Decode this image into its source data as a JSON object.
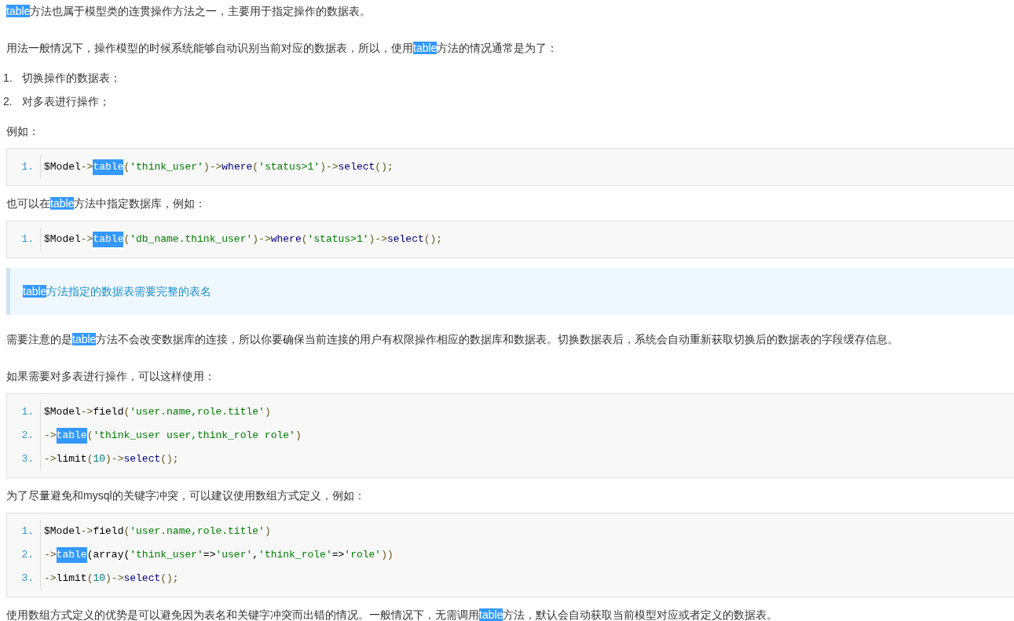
{
  "content": [
    {
      "kind": "paragraph",
      "segments": [
        {
          "text": "table",
          "highlighted": true
        },
        {
          "text": "方法也属于模型类的连贯操作方法之一，主要用于指定操作的数据表。",
          "highlighted": false
        }
      ]
    },
    {
      "kind": "paragraph",
      "segments": [
        {
          "text": "用法一般情况下，操作模型的时候系统能够自动识别当前对应的数据表，所以，使用",
          "highlighted": false
        },
        {
          "text": "table",
          "highlighted": true
        },
        {
          "text": "方法的情况通常是为了：",
          "highlighted": false
        }
      ]
    },
    {
      "kind": "list",
      "items": [
        {
          "number": "1.",
          "text": "切换操作的数据表；"
        },
        {
          "number": "2.",
          "text": "对多表进行操作；"
        }
      ]
    },
    {
      "kind": "paragraph",
      "segments": [
        {
          "text": "例如：",
          "highlighted": false
        }
      ]
    },
    {
      "kind": "code",
      "lines": [
        {
          "number": "1.",
          "tokens": [
            {
              "text": "$Model",
              "kind": "plain"
            },
            {
              "text": "->",
              "kind": "punct"
            },
            {
              "text": "table",
              "kind": "highlight"
            },
            {
              "text": "(",
              "kind": "punct"
            },
            {
              "text": "'think_user'",
              "kind": "string"
            },
            {
              "text": ")->",
              "kind": "punct"
            },
            {
              "text": "where",
              "kind": "method"
            },
            {
              "text": "(",
              "kind": "punct"
            },
            {
              "text": "'status>1'",
              "kind": "string"
            },
            {
              "text": ")->",
              "kind": "punct"
            },
            {
              "text": "select",
              "kind": "method"
            },
            {
              "text": "();",
              "kind": "punct"
            }
          ]
        }
      ]
    },
    {
      "kind": "paragraph",
      "segments": [
        {
          "text": "也可以在",
          "highlighted": false
        },
        {
          "text": "table",
          "highlighted": true
        },
        {
          "text": "方法中指定数据库，例如：",
          "highlighted": false
        }
      ]
    },
    {
      "kind": "code",
      "lines": [
        {
          "number": "1.",
          "tokens": [
            {
              "text": "$Model",
              "kind": "plain"
            },
            {
              "text": "->",
              "kind": "punct"
            },
            {
              "text": "table",
              "kind": "highlight"
            },
            {
              "text": "(",
              "kind": "punct"
            },
            {
              "text": "'db_name.think_user'",
              "kind": "string"
            },
            {
              "text": ")->",
              "kind": "punct"
            },
            {
              "text": "where",
              "kind": "method"
            },
            {
              "text": "(",
              "kind": "punct"
            },
            {
              "text": "'status>1'",
              "kind": "string"
            },
            {
              "text": ")->",
              "kind": "punct"
            },
            {
              "text": "select",
              "kind": "method"
            },
            {
              "text": "();",
              "kind": "punct"
            }
          ]
        }
      ]
    },
    {
      "kind": "note",
      "segments": [
        {
          "text": "table",
          "highlighted": true
        },
        {
          "text": "方法指定的数据表需要完整的表名",
          "highlighted": false
        }
      ]
    },
    {
      "kind": "paragraph",
      "segments": [
        {
          "text": "需要注意的是",
          "highlighted": false
        },
        {
          "text": "table",
          "highlighted": true
        },
        {
          "text": "方法不会改变数据库的连接，所以你要确保当前连接的用户有权限操作相应的数据库和数据表。切换数据表后，系统会自动重新获取切换后的数据表的字段缓存信息。",
          "highlighted": false
        }
      ]
    },
    {
      "kind": "paragraph",
      "segments": [
        {
          "text": "如果需要对多表进行操作，可以这样使用：",
          "highlighted": false
        }
      ]
    },
    {
      "kind": "code",
      "lines": [
        {
          "number": "1.",
          "tokens": [
            {
              "text": "$Model",
              "kind": "plain"
            },
            {
              "text": "->",
              "kind": "punct"
            },
            {
              "text": "field",
              "kind": "plain"
            },
            {
              "text": "(",
              "kind": "punct"
            },
            {
              "text": "'user.name,role.title'",
              "kind": "string"
            },
            {
              "text": ")",
              "kind": "punct"
            }
          ]
        },
        {
          "number": "2.",
          "tokens": [
            {
              "text": "->",
              "kind": "punct"
            },
            {
              "text": "table",
              "kind": "highlight"
            },
            {
              "text": "(",
              "kind": "punct"
            },
            {
              "text": "'think_user user,think_role role'",
              "kind": "string"
            },
            {
              "text": ")",
              "kind": "punct"
            }
          ]
        },
        {
          "number": "3.",
          "tokens": [
            {
              "text": "->",
              "kind": "punct"
            },
            {
              "text": "limit",
              "kind": "plain"
            },
            {
              "text": "(",
              "kind": "punct"
            },
            {
              "text": "10",
              "kind": "number"
            },
            {
              "text": ")->",
              "kind": "punct"
            },
            {
              "text": "select",
              "kind": "method"
            },
            {
              "text": "();",
              "kind": "punct"
            }
          ]
        }
      ]
    },
    {
      "kind": "paragraph",
      "segments": [
        {
          "text": "为了尽量避免和mysql的关键字冲突，可以建议使用数组方式定义，例如：",
          "highlighted": false
        }
      ]
    },
    {
      "kind": "code",
      "lines": [
        {
          "number": "1.",
          "tokens": [
            {
              "text": "$Model",
              "kind": "plain"
            },
            {
              "text": "->",
              "kind": "punct"
            },
            {
              "text": "field",
              "kind": "plain"
            },
            {
              "text": "(",
              "kind": "punct"
            },
            {
              "text": "'user.name,role.title'",
              "kind": "string"
            },
            {
              "text": ")",
              "kind": "punct"
            }
          ]
        },
        {
          "number": "2.",
          "tokens": [
            {
              "text": "->",
              "kind": "punct"
            },
            {
              "text": "table",
              "kind": "highlight"
            },
            {
              "text": "(array(",
              "kind": "plain"
            },
            {
              "text": "'think_user'",
              "kind": "string"
            },
            {
              "text": "=>",
              "kind": "plain"
            },
            {
              "text": "'user'",
              "kind": "string"
            },
            {
              "text": ",",
              "kind": "plain"
            },
            {
              "text": "'think_role'",
              "kind": "string"
            },
            {
              "text": "=>",
              "kind": "plain"
            },
            {
              "text": "'role'",
              "kind": "string"
            },
            {
              "text": "))",
              "kind": "punct"
            }
          ]
        },
        {
          "number": "3.",
          "tokens": [
            {
              "text": "->",
              "kind": "punct"
            },
            {
              "text": "limit",
              "kind": "plain"
            },
            {
              "text": "(",
              "kind": "punct"
            },
            {
              "text": "10",
              "kind": "number"
            },
            {
              "text": ")->",
              "kind": "punct"
            },
            {
              "text": "select",
              "kind": "method"
            },
            {
              "text": "();",
              "kind": "punct"
            }
          ]
        }
      ]
    },
    {
      "kind": "paragraph",
      "segments": [
        {
          "text": "使用数组方式定义的优势是可以避免因为表名和关键字冲突而出错的情况。一般情况下，无需调用",
          "highlighted": false
        },
        {
          "text": "table",
          "highlighted": true
        },
        {
          "text": "方法，默认会自动获取当前模型对应或者定义的数据表。",
          "highlighted": false
        }
      ]
    }
  ]
}
